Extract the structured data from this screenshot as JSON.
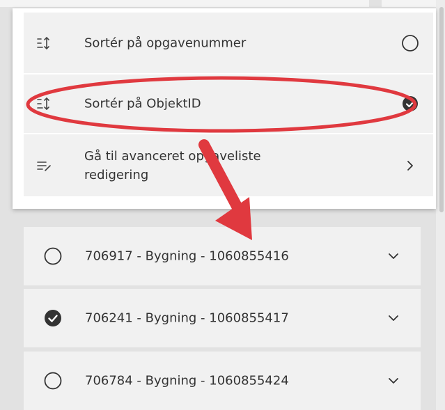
{
  "menu": {
    "items": [
      {
        "label": "Sortér på opgavenummer",
        "icon": "sort-arrows-icon",
        "state": "unselected"
      },
      {
        "label": "Sortér på ObjektID",
        "icon": "sort-arrows-icon",
        "state": "selected"
      },
      {
        "label": "Gå til avanceret opgaveliste redigering",
        "icon": "edit-list-icon",
        "state": "navigate"
      }
    ]
  },
  "tasks": [
    {
      "label": "706917 - Bygning - 1060855416",
      "checked": false
    },
    {
      "label": "706241 - Bygning - 1060855417",
      "checked": true
    },
    {
      "label": "706784 - Bygning - 1060855424",
      "checked": false
    }
  ],
  "colors": {
    "panel_bg": "#ffffff",
    "item_bg": "#f1f1f1",
    "page_bg": "#e2e2e2",
    "annotation_red": "#e0393f",
    "text": "#333333"
  }
}
